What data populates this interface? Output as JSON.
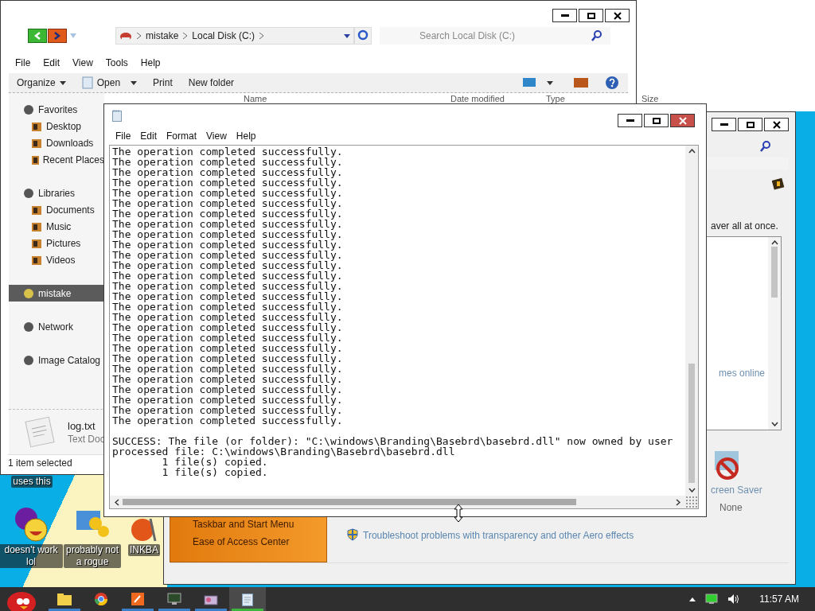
{
  "explorer": {
    "breadcrumb": [
      "mistake",
      "Local Disk (C:)"
    ],
    "search": {
      "placeholder": "Search Local Disk (C:)"
    },
    "menu": [
      "File",
      "Edit",
      "View",
      "Tools",
      "Help"
    ],
    "toolbar": [
      {
        "label": "Organize",
        "kind": "menu"
      },
      {
        "label": "Open",
        "kind": "split"
      },
      {
        "label": "Print",
        "kind": "plain"
      },
      {
        "label": "New folder",
        "kind": "plain"
      }
    ],
    "columns": [
      "Name",
      "Date modified",
      "Type",
      "Size"
    ],
    "sidebar": [
      {
        "label": "Favorites",
        "selected": false,
        "children": [
          {
            "label": "Desktop",
            "selected": false
          },
          {
            "label": "Downloads",
            "selected": false
          },
          {
            "label": "Recent Places",
            "selected": false
          }
        ]
      },
      {
        "label": "Libraries",
        "selected": false,
        "children": [
          {
            "label": "Documents",
            "selected": false
          },
          {
            "label": "Music",
            "selected": false
          },
          {
            "label": "Pictures",
            "selected": false
          },
          {
            "label": "Videos",
            "selected": false
          }
        ]
      },
      {
        "label": "mistake",
        "selected": true
      },
      {
        "label": "Network",
        "selected": false
      },
      {
        "label": "Image Catalog",
        "selected": false
      }
    ],
    "details": {
      "name": "log.txt",
      "type": "Text Doc"
    },
    "status": "1 item selected"
  },
  "notepad": {
    "menu": [
      "File",
      "Edit",
      "Format",
      "View",
      "Help"
    ],
    "output_lines": [
      "The operation completed successfully.",
      "The operation completed successfully.",
      "The operation completed successfully.",
      "The operation completed successfully.",
      "The operation completed successfully.",
      "The operation completed successfully.",
      "The operation completed successfully.",
      "The operation completed successfully.",
      "The operation completed successfully.",
      "The operation completed successfully.",
      "The operation completed successfully.",
      "The operation completed successfully.",
      "The operation completed successfully.",
      "The operation completed successfully.",
      "The operation completed successfully.",
      "The operation completed successfully.",
      "The operation completed successfully.",
      "The operation completed successfully.",
      "The operation completed successfully.",
      "The operation completed successfully.",
      "The operation completed successfully.",
      "The operation completed successfully.",
      "The operation completed successfully.",
      "The operation completed successfully.",
      "The operation completed successfully.",
      "The operation completed successfully.",
      "The operation completed successfully."
    ],
    "summary_lines": [
      "SUCCESS: The file (or folder): \"C:\\windows\\Branding\\Basebrd\\basebrd.dll\" now owned by user",
      "processed file: C:\\windows\\Branding\\Basebrd\\basebrd.dll",
      "        1 file(s) copied.",
      "        1 file(s) copied."
    ]
  },
  "control_panel": {
    "intro_fragment": "aver all at once.",
    "list_item": "mes online",
    "screen_saver": {
      "label": "creen Saver",
      "value": "None"
    },
    "see_also": [
      "Taskbar and Start Menu",
      "Ease of Access Center"
    ],
    "troubleshoot_link": "Troubleshoot problems with transparency and other Aero effects"
  },
  "desktop_icons": [
    {
      "label": "uses this",
      "kind": "hidden"
    },
    {
      "label": "doesn't work lol",
      "kind": "messenger"
    },
    {
      "label": "probably not a rogue",
      "kind": "gears"
    },
    {
      "label": "INKBA",
      "kind": "pen"
    }
  ],
  "taskbar": {
    "apps": [
      {
        "kind": "folder",
        "running": true,
        "selected": false
      },
      {
        "kind": "browser",
        "running": false,
        "selected": false
      },
      {
        "kind": "drawing",
        "running": true,
        "selected": false
      },
      {
        "kind": "terminal",
        "running": true,
        "selected": false
      },
      {
        "kind": "paint",
        "running": true,
        "selected": false
      },
      {
        "kind": "notepad",
        "running": true,
        "selected": true
      }
    ],
    "clock": "11:57 AM"
  }
}
